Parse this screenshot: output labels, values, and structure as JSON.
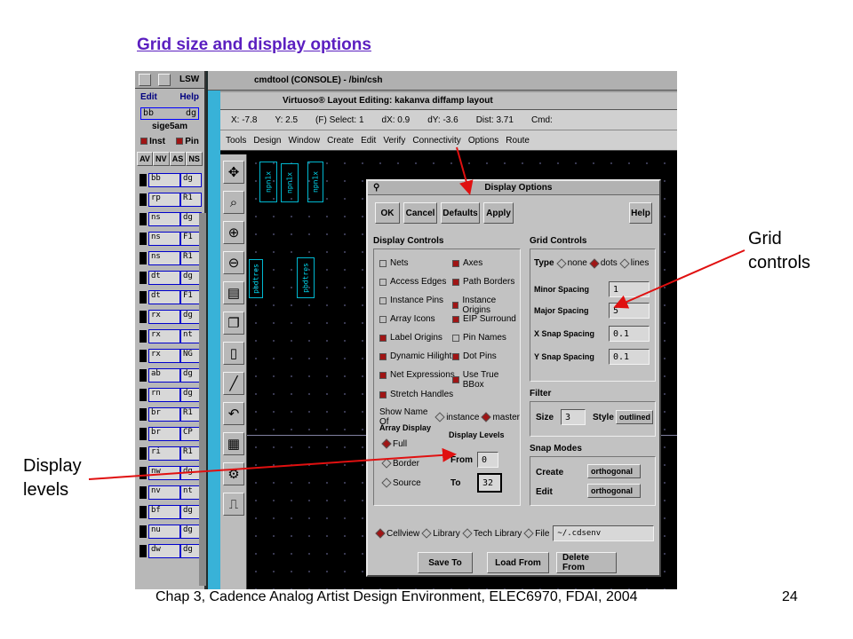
{
  "slide": {
    "title": "Grid size and display options",
    "footer": "Chap 3, Cadence Analog Artist Design Environment, ELEC6970, FDAI, 2004",
    "page_number": "24",
    "callout_grid": "Grid\ncontrols",
    "callout_grid_1": "Grid",
    "callout_grid_2": "controls",
    "callout_display_1": "Display",
    "callout_display_2": "levels"
  },
  "lsw": {
    "title": "LSW",
    "menu": [
      "Edit",
      "Help"
    ],
    "current_layer": "bb",
    "current_purpose": "dg",
    "tech": "sige5am",
    "checks": [
      "Inst",
      "Pin"
    ],
    "buttons": [
      "AV",
      "NV",
      "AS",
      "NS"
    ],
    "layers": [
      {
        "name": "bb",
        "purpose": "dg"
      },
      {
        "name": "rp",
        "purpose": "R1"
      },
      {
        "name": "ns",
        "purpose": "dg"
      },
      {
        "name": "ns",
        "purpose": "F1"
      },
      {
        "name": "ns",
        "purpose": "R1"
      },
      {
        "name": "dt",
        "purpose": "dg"
      },
      {
        "name": "dt",
        "purpose": "F1"
      },
      {
        "name": "rx",
        "purpose": "dg"
      },
      {
        "name": "rx",
        "purpose": "nt"
      },
      {
        "name": "rx",
        "purpose": "NG"
      },
      {
        "name": "ab",
        "purpose": "dg"
      },
      {
        "name": "rn",
        "purpose": "dg"
      },
      {
        "name": "br",
        "purpose": "R1"
      },
      {
        "name": "br",
        "purpose": "CP"
      },
      {
        "name": "ri",
        "purpose": "R1"
      },
      {
        "name": "nw",
        "purpose": "dg"
      },
      {
        "name": "nv",
        "purpose": "nt"
      },
      {
        "name": "bf",
        "purpose": "dg"
      },
      {
        "name": "nu",
        "purpose": "dg"
      },
      {
        "name": "dw",
        "purpose": "dg"
      }
    ]
  },
  "cmdtool": {
    "title": "cmdtool (CONSOLE) - /bin/csh"
  },
  "layout_window": {
    "title": "Virtuoso® Layout Editing: kakanva diffamp layout",
    "status": {
      "x": "X: -7.8",
      "y": "Y: 2.5",
      "select": "(F) Select: 1",
      "dx": "dX: 0.9",
      "dy": "dY: -3.6",
      "dist": "Dist: 3.71",
      "cmd": "Cmd:"
    },
    "menu": [
      "Tools",
      "Design",
      "Window",
      "Create",
      "Edit",
      "Verify",
      "Connectivity",
      "Options",
      "Route"
    ],
    "instances": [
      "npn1x",
      "npn1x",
      "npn1x",
      "pbdtres",
      "pbdtres"
    ]
  },
  "dialog": {
    "title": "Display Options",
    "buttons": [
      "OK",
      "Cancel",
      "Defaults",
      "Apply",
      "Help"
    ],
    "display_controls": {
      "title": "Display Controls",
      "left": [
        {
          "label": "Nets",
          "on": false
        },
        {
          "label": "Access Edges",
          "on": false
        },
        {
          "label": "Instance Pins",
          "on": false
        },
        {
          "label": "Array Icons",
          "on": false
        },
        {
          "label": "Label Origins",
          "on": true
        },
        {
          "label": "Dynamic Hilight",
          "on": true
        },
        {
          "label": "Net Expressions",
          "on": true
        }
      ],
      "right": [
        {
          "label": "Axes",
          "on": true
        },
        {
          "label": "Path Borders",
          "on": true
        },
        {
          "label": "Instance Origins",
          "on": true
        },
        {
          "label": "EIP Surround",
          "on": true
        },
        {
          "label": "Pin Names",
          "on": false
        },
        {
          "label": "Dot Pins",
          "on": true
        },
        {
          "label": "Use True BBox",
          "on": true
        }
      ],
      "stretch_handles": "Stretch Handles",
      "show_name_of": "Show Name Of",
      "show_name_options": [
        "instance",
        "master"
      ],
      "array_display": "Array Display",
      "array_options": [
        "Full",
        "Border",
        "Source"
      ],
      "display_levels": "Display Levels",
      "from_label": "From",
      "from_value": "0",
      "to_label": "To",
      "to_value": "32"
    },
    "grid_controls": {
      "title": "Grid Controls",
      "type_label": "Type",
      "type_options": [
        "none",
        "dots",
        "lines"
      ],
      "minor_label": "Minor Spacing",
      "minor_value": "1",
      "major_label": "Major Spacing",
      "major_value": "5",
      "xsnap_label": "X Snap Spacing",
      "xsnap_value": "0.1",
      "ysnap_label": "Y Snap Spacing",
      "ysnap_value": "0.1"
    },
    "filter": {
      "title": "Filter",
      "size_label": "Size",
      "size_value": "3",
      "style_label": "Style",
      "style_value": "outlined"
    },
    "snap_modes": {
      "title": "Snap Modes",
      "create_label": "Create",
      "create_value": "orthogonal",
      "edit_label": "Edit",
      "edit_value": "orthogonal"
    },
    "save_scope": {
      "options": [
        "Cellview",
        "Library",
        "Tech Library",
        "File"
      ],
      "file_value": "~/.cdsenv"
    },
    "bottom_buttons": [
      "Save To",
      "Load From",
      "Delete From"
    ]
  },
  "colors": {
    "title": "#5b1fc0",
    "arrow": "#e01010",
    "check_on": "#a01515"
  }
}
